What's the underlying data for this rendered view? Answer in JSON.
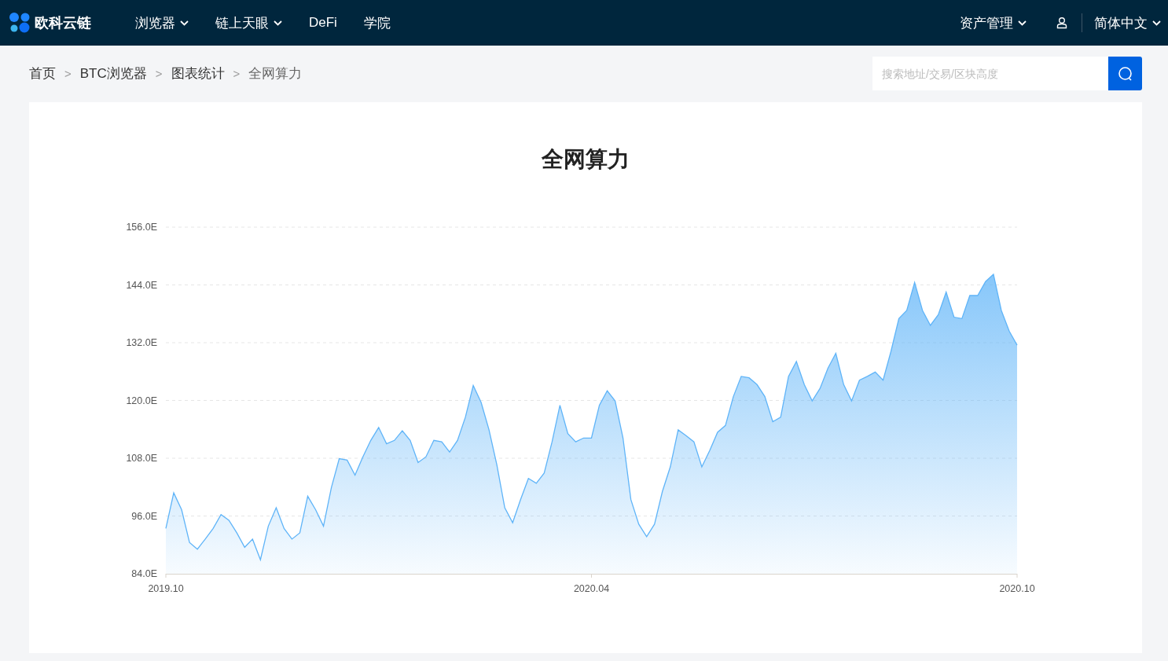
{
  "header": {
    "logo": {
      "text": "欧科云链"
    },
    "nav": [
      {
        "label": "浏览器",
        "dropdown": true
      },
      {
        "label": "链上天眼",
        "dropdown": true
      },
      {
        "label": "DeFi",
        "dropdown": false
      },
      {
        "label": "学院",
        "dropdown": false
      }
    ],
    "right": [
      {
        "kind": "menu",
        "label": "资产管理",
        "dropdown": true
      },
      {
        "kind": "user"
      },
      {
        "kind": "menu",
        "label": "简体中文",
        "dropdown": true
      }
    ]
  },
  "breadcrumb": [
    {
      "label": "首页",
      "current": false
    },
    {
      "separator": ">",
      "label": "BTC浏览器",
      "current": false
    },
    {
      "separator": ">",
      "label": "图表统计",
      "current": false
    },
    {
      "separator": ">",
      "label": "全网算力",
      "current": true
    }
  ],
  "search": {
    "placeholder": "搜索地址/交易/区块高度"
  },
  "card": {
    "title": "全网算力",
    "chart_data": {
      "type": "area",
      "ylim": [
        84,
        156
      ],
      "yticks": [
        {
          "value": 84,
          "label": "84.0E"
        },
        {
          "value": 96,
          "label": "96.0E"
        },
        {
          "value": 108,
          "label": "108.0E"
        },
        {
          "value": 120,
          "label": "120.0E"
        },
        {
          "value": 132,
          "label": "132.0E"
        },
        {
          "value": 144,
          "label": "144.0E"
        },
        {
          "value": 156,
          "label": "156.0E"
        }
      ],
      "grid": true,
      "categories": [
        "2019.10",
        null,
        null,
        null,
        null,
        null,
        null,
        null,
        null,
        null,
        null,
        null,
        null,
        null,
        null,
        null,
        null,
        null,
        null,
        null,
        null,
        null,
        null,
        null,
        null,
        null,
        null,
        null,
        null,
        null,
        null,
        null,
        null,
        null,
        null,
        null,
        null,
        null,
        null,
        null,
        null,
        null,
        null,
        null,
        null,
        null,
        null,
        null,
        null,
        null,
        null,
        null,
        null,
        null,
        "2020.04",
        null,
        null,
        null,
        null,
        null,
        null,
        null,
        null,
        null,
        null,
        null,
        null,
        null,
        null,
        null,
        null,
        null,
        null,
        null,
        null,
        null,
        null,
        null,
        null,
        null,
        null,
        null,
        null,
        null,
        null,
        null,
        null,
        null,
        null,
        null,
        null,
        null,
        null,
        null,
        null,
        null,
        null,
        null,
        null,
        null,
        null,
        null,
        null,
        null,
        null,
        null,
        null,
        null,
        "2020.10"
      ],
      "series": [
        {
          "color": "#5fb4f8",
          "values": [
            93.4,
            100.8,
            97.3,
            90.5,
            89.1,
            91.2,
            93.4,
            96.3,
            95.1,
            92.5,
            89.5,
            91.2,
            86.9,
            93.9,
            97.7,
            93.4,
            91.2,
            92.5,
            100.1,
            97.3,
            93.9,
            101.9,
            107.9,
            107.6,
            104.5,
            108.3,
            111.7,
            114.4,
            111,
            111.7,
            113.7,
            111.7,
            107.1,
            108.3,
            111.7,
            111.4,
            109.3,
            111.7,
            116.5,
            123.1,
            119.6,
            113.9,
            106.6,
            97.7,
            94.6,
            99.4,
            103.8,
            102.8,
            104.9,
            111.4,
            119,
            113.1,
            111.4,
            112.2,
            112.2,
            119,
            122,
            119.9,
            112.2,
            99.4,
            94.3,
            91.7,
            94.3,
            101.1,
            106.2,
            113.9,
            112.7,
            111.4,
            106.2,
            109.6,
            113.4,
            114.8,
            120.8,
            125,
            124.7,
            123.3,
            120.8,
            115.6,
            116.5,
            125,
            128.1,
            123.3,
            119.9,
            122.5,
            126.7,
            129.8,
            123.3,
            119.9,
            124.2,
            125,
            125.9,
            124.2,
            130.2,
            137,
            138.7,
            144.5,
            138.7,
            135.6,
            137.8,
            142.5,
            137.3,
            137,
            141.8,
            141.8,
            144.7,
            146.2,
            138.7,
            134.4,
            131.5
          ]
        }
      ]
    }
  }
}
